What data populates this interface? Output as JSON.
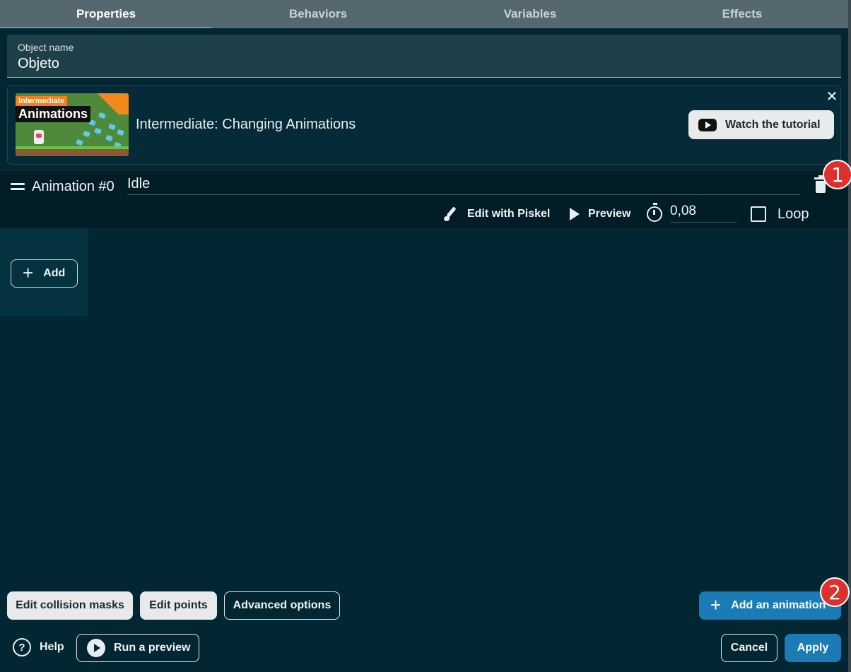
{
  "tabs": [
    {
      "label": "Properties"
    },
    {
      "label": "Behaviors"
    },
    {
      "label": "Variables"
    },
    {
      "label": "Effects"
    }
  ],
  "object_name": {
    "label": "Object name",
    "value": "Objeto"
  },
  "tutorial": {
    "thumbnail_tag": "Intermediate",
    "thumbnail_title": "Animations",
    "title": "Intermediate: Changing Animations",
    "watch_label": "Watch the tutorial",
    "close_icon": "close-icon"
  },
  "animation": {
    "label": "Animation #0",
    "name": "Idle",
    "edit_label": "Edit with Piskel",
    "preview_label": "Preview",
    "speed": "0,08",
    "loop_label": "Loop",
    "loop_checked": false,
    "add_frame_label": "Add"
  },
  "badges": [
    "1",
    "2"
  ],
  "footer": {
    "edit_collision_masks": "Edit collision masks",
    "edit_points": "Edit points",
    "advanced_options": "Advanced options",
    "add_animation": "Add an animation",
    "help": "Help",
    "run_preview": "Run a preview",
    "cancel": "Cancel",
    "apply": "Apply"
  },
  "colors": {
    "background": "#022632",
    "tab_bar": "#55686f",
    "primary": "#1a7bb5",
    "badge": "#e0302e"
  }
}
